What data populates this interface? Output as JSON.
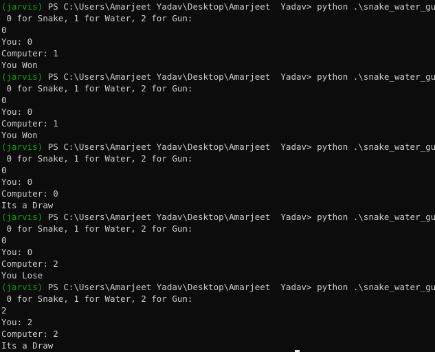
{
  "colors": {
    "background": "#0c0c0c",
    "text": "#cccccc",
    "env_prefix": "#13a10e"
  },
  "terminal": {
    "env": "(jarvis)",
    "prompt_path": " PS C:\\Users\\Amarjeet Yadav\\Desktop\\Amarjeet  Yadav> ",
    "command": "python .\\snake_water_gun.py",
    "runs": [
      {
        "instruction": " 0 for Snake, 1 for Water, 2 for Gun:",
        "input": "0",
        "you": "You: 0",
        "computer": "Computer: 1",
        "result": "You Won"
      },
      {
        "instruction": " 0 for Snake, 1 for Water, 2 for Gun:",
        "input": "0",
        "you": "You: 0",
        "computer": "Computer: 1",
        "result": "You Won"
      },
      {
        "instruction": " 0 for Snake, 1 for Water, 2 for Gun:",
        "input": "0",
        "you": "You: 0",
        "computer": "Computer: 0",
        "result": "Its a Draw"
      },
      {
        "instruction": " 0 for Snake, 1 for Water, 2 for Gun:",
        "input": "0",
        "you": "You: 0",
        "computer": "Computer: 2",
        "result": "You Lose"
      },
      {
        "instruction": " 0 for Snake, 1 for Water, 2 for Gun:",
        "input": "2",
        "you": "You: 2",
        "computer": "Computer: 2",
        "result": "Its a Draw"
      }
    ]
  }
}
